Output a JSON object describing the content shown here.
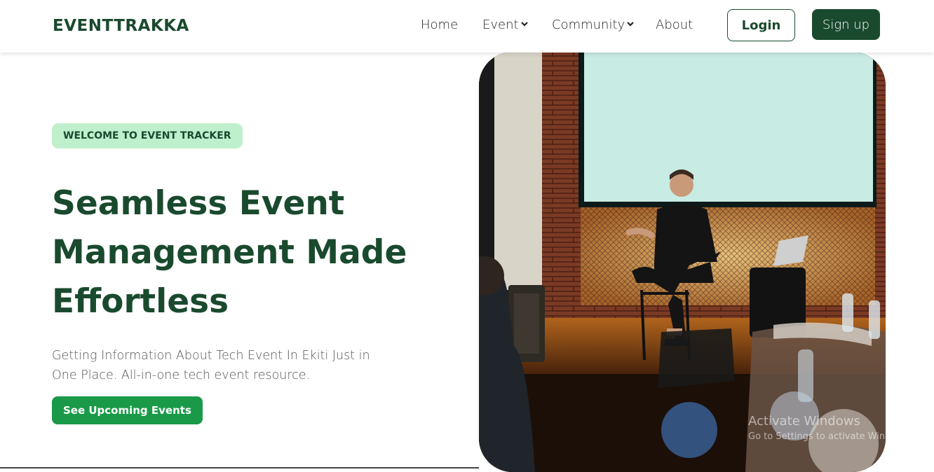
{
  "nav": {
    "brand": "EVENTTRAKKA",
    "items": [
      {
        "label": "Home"
      },
      {
        "label": "Event"
      },
      {
        "label": "Community"
      },
      {
        "label": "About"
      }
    ],
    "login_label": "Login",
    "signup_label": "Sign up"
  },
  "hero": {
    "badge": "WELCOME TO EVENT TRACKER",
    "headline_line1": "Seamless Event",
    "headline_line2": "Management Made",
    "headline_line3": "Effortless",
    "subtext": "Getting Information About Tech Event In Ekiti Just in One Place. All-in-one tech event resource.",
    "cta_label": "See Upcoming Events",
    "image_alt": "speaker-on-stage-photo"
  },
  "watermark": {
    "line1": "Activate Windows",
    "line2": "Go to Settings to activate Windows."
  },
  "colors": {
    "brand_dark_green": "#1a4a2e",
    "cta_green": "#1a9a48",
    "badge_bg": "#bff0cd"
  }
}
